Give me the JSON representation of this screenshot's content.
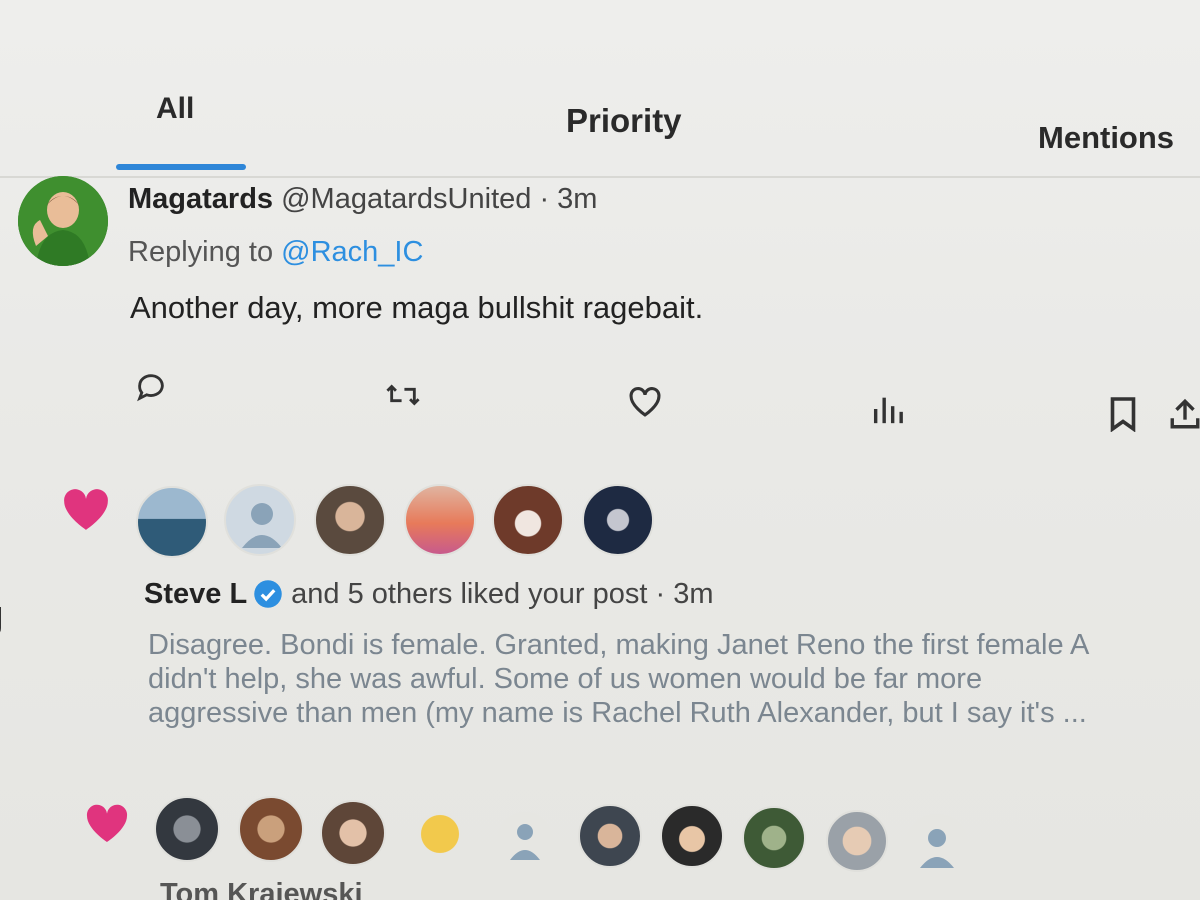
{
  "tabs": {
    "all": "All",
    "priority": "Priority",
    "mentions": "Mentions"
  },
  "reply_notification": {
    "author_name": "Magatards",
    "author_meta": "@MagatardsUnited · 3m",
    "replying_prefix": "Replying to ",
    "replying_handle": "@Rach_IC",
    "text": "Another day, more maga bullshit ragebait.",
    "actions": [
      "reply-icon",
      "repost-icon",
      "like-icon",
      "views-icon",
      "bookmark-icon",
      "share-icon"
    ]
  },
  "like_notification": {
    "liker_name": "Steve L",
    "liker_suffix": "and 5 others liked your post · 3m",
    "quote_lines": [
      "Disagree. Bondi is female. Granted, making Janet Reno the first female A",
      "didn't help, she was awful. Some of us women would be far more",
      "aggressive than men (my name is Rachel Ruth Alexander, but I say it's ..."
    ]
  },
  "next_notification": {
    "cut_name": "Tom Krajewski"
  },
  "colors": {
    "accent": "#2e86d8",
    "handle": "#2d8fe0",
    "heart": "#e0347e",
    "verified": "#2d8fe0"
  }
}
